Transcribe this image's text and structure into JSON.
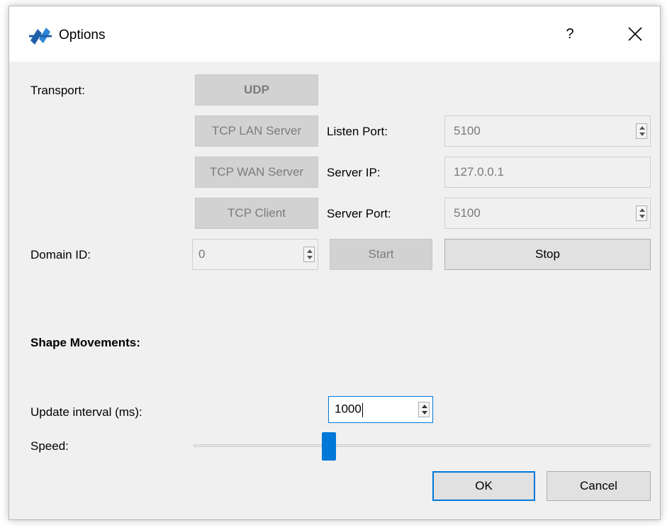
{
  "window": {
    "title": "Options",
    "help_label": "?"
  },
  "transport": {
    "label": "Transport:",
    "udp_label": "UDP",
    "tcp_lan_label": "TCP LAN Server",
    "tcp_wan_label": "TCP WAN Server",
    "tcp_client_label": "TCP Client",
    "listen_port": {
      "label": "Listen Port:",
      "value": "5100"
    },
    "server_ip": {
      "label": "Server IP:",
      "value": "127.0.0.1"
    },
    "server_port": {
      "label": "Server Port:",
      "value": "5100"
    }
  },
  "domain": {
    "label": "Domain ID:",
    "value": "0",
    "start_label": "Start",
    "stop_label": "Stop"
  },
  "shape_movements": {
    "heading": "Shape Movements:",
    "update_interval": {
      "label": "Update interval (ms):",
      "value": "1000"
    },
    "speed": {
      "label": "Speed:",
      "level_fraction": 0.29
    }
  },
  "footer": {
    "ok_label": "OK",
    "cancel_label": "Cancel"
  },
  "colors": {
    "accent": "#0078d7",
    "dialog_background": "#f0f0f0",
    "disabled_text": "#7c7c7c"
  },
  "icons": {
    "app": "rti-logo-icon",
    "close": "close-icon"
  }
}
